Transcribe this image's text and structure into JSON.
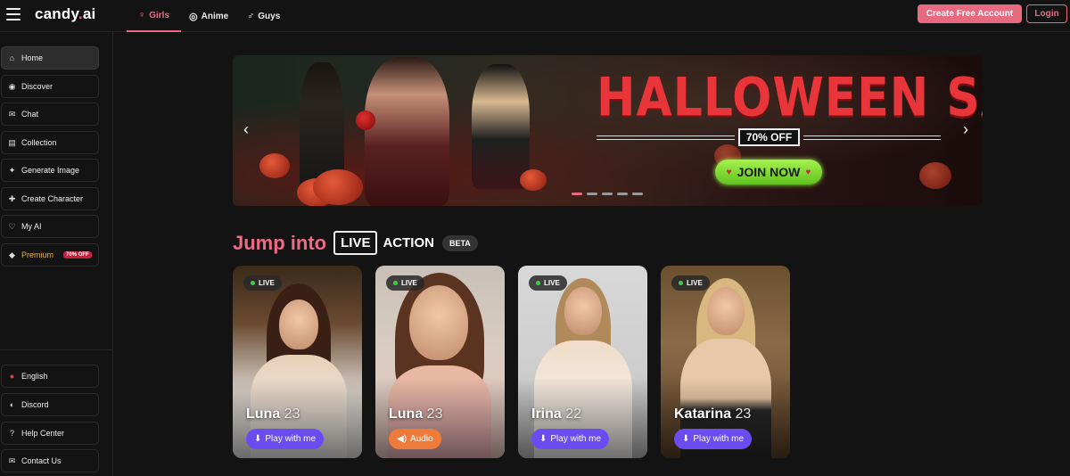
{
  "header": {
    "logo_main": "candy",
    "logo_dot": ".",
    "logo_tail": "ai",
    "tabs": [
      {
        "label": "Girls",
        "icon": "♀"
      },
      {
        "label": "Anime",
        "icon": "◎"
      },
      {
        "label": "Guys",
        "icon": "♂"
      }
    ],
    "create_label": "Create Free Account",
    "login_label": "Login"
  },
  "sidebar": {
    "items": [
      {
        "label": "Home",
        "icon": "⌂"
      },
      {
        "label": "Discover",
        "icon": "◉"
      },
      {
        "label": "Chat",
        "icon": "✉"
      },
      {
        "label": "Collection",
        "icon": "▤"
      },
      {
        "label": "Generate Image",
        "icon": "✦"
      },
      {
        "label": "Create Character",
        "icon": "✚"
      },
      {
        "label": "My AI",
        "icon": "♡"
      },
      {
        "label": "Premium",
        "icon": "◆",
        "badge": "70% OFF"
      }
    ],
    "bottom_items": [
      {
        "label": "English",
        "icon": "●"
      },
      {
        "label": "Discord",
        "icon": "◐"
      },
      {
        "label": "Help Center",
        "icon": "?"
      },
      {
        "label": "Contact Us",
        "icon": "✉"
      }
    ]
  },
  "banner": {
    "title": "HALLOWEEN SALE",
    "discount": "70% OFF",
    "cta": "JOIN NOW",
    "heart_icon": "♥",
    "slides": 5,
    "active_slide": 1
  },
  "section": {
    "jump": "Jump into",
    "live": "LIVE",
    "action": "ACTION",
    "beta": "BETA"
  },
  "cards": [
    {
      "live": "LIVE",
      "name": "Luna",
      "age": "23",
      "button": "Play with me",
      "button_icon": "⬇",
      "type": "play"
    },
    {
      "live": "LIVE",
      "name": "Luna",
      "age": "23",
      "button": "Audio",
      "button_icon": "◀)",
      "type": "audio"
    },
    {
      "live": "LIVE",
      "name": "Irina",
      "age": "22",
      "button": "Play with me",
      "button_icon": "⬇",
      "type": "play"
    },
    {
      "live": "LIVE",
      "name": "Katarina",
      "age": "23",
      "button": "Play with me",
      "button_icon": "⬇",
      "type": "play"
    }
  ],
  "colors": {
    "accent": "#e86a80",
    "live_dot": "#3ad23a",
    "play_button": "#6a4cf0",
    "audio_button": "#f07a3a",
    "premium": "#e3b04b"
  }
}
